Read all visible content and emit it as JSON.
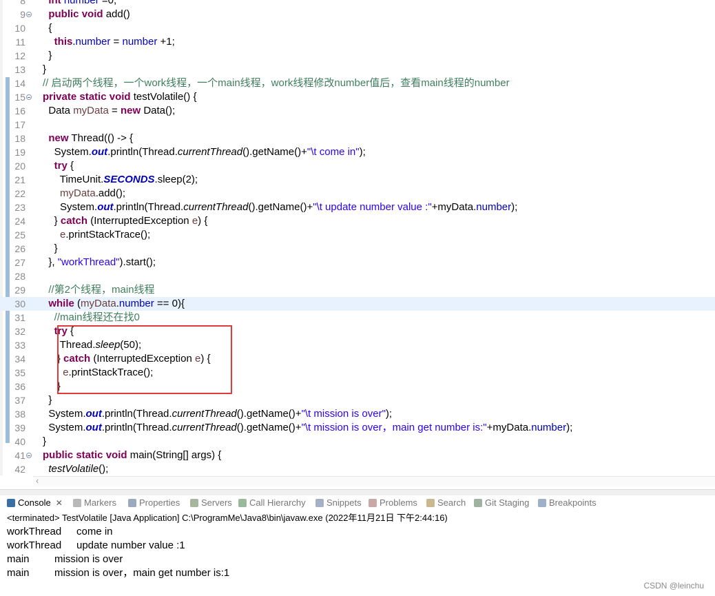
{
  "editor": {
    "lines": [
      {
        "num": "8",
        "fold": false,
        "tokens": [
          [
            "  ",
            ""
          ],
          [
            "int",
            "kw"
          ],
          [
            " ",
            ""
          ],
          [
            "number",
            "fld"
          ],
          [
            " =0;",
            ""
          ]
        ]
      },
      {
        "num": "9",
        "fold": true,
        "tokens": [
          [
            "  ",
            ""
          ],
          [
            "public",
            "kw"
          ],
          [
            " ",
            ""
          ],
          [
            "void",
            "kw"
          ],
          [
            " add()",
            ""
          ]
        ]
      },
      {
        "num": "10",
        "fold": false,
        "tokens": [
          [
            "  {",
            ""
          ]
        ]
      },
      {
        "num": "11",
        "fold": false,
        "tokens": [
          [
            "    ",
            ""
          ],
          [
            "this",
            "kw"
          ],
          [
            ".",
            ""
          ],
          [
            "number",
            "fld"
          ],
          [
            " = ",
            ""
          ],
          [
            "number",
            "fld"
          ],
          [
            " +1;",
            ""
          ]
        ]
      },
      {
        "num": "12",
        "fold": false,
        "tokens": [
          [
            "  }",
            ""
          ]
        ]
      },
      {
        "num": "13",
        "fold": false,
        "tokens": [
          [
            "}",
            ""
          ]
        ]
      },
      {
        "num": "14",
        "fold": false,
        "tokens": [
          [
            "// 启动两个线程，一个work线程，一个main线程，work线程修改number值后，查看main线程的number",
            "cmt"
          ]
        ]
      },
      {
        "num": "15",
        "fold": true,
        "tokens": [
          [
            "private",
            "kw"
          ],
          [
            " ",
            ""
          ],
          [
            "static",
            "kw"
          ],
          [
            " ",
            ""
          ],
          [
            "void",
            "kw"
          ],
          [
            " testVolatile() {",
            ""
          ]
        ]
      },
      {
        "num": "16",
        "fold": false,
        "tokens": [
          [
            "  Data ",
            ""
          ],
          [
            "myData",
            "var"
          ],
          [
            " = ",
            ""
          ],
          [
            "new",
            "kw"
          ],
          [
            " Data();",
            ""
          ]
        ]
      },
      {
        "num": "17",
        "fold": false,
        "tokens": [
          [
            "",
            ""
          ]
        ]
      },
      {
        "num": "18",
        "fold": false,
        "tokens": [
          [
            "  ",
            ""
          ],
          [
            "new",
            "kw"
          ],
          [
            " Thread(() -> {",
            ""
          ]
        ]
      },
      {
        "num": "19",
        "fold": false,
        "tokens": [
          [
            "    System.",
            ""
          ],
          [
            "out",
            "sfld"
          ],
          [
            ".println(Thread.",
            ""
          ],
          [
            "currentThread",
            "it"
          ],
          [
            "().getName()+",
            ""
          ],
          [
            "\"\\t come in\"",
            "str"
          ],
          [
            ");",
            ""
          ]
        ]
      },
      {
        "num": "20",
        "fold": false,
        "tokens": [
          [
            "    ",
            ""
          ],
          [
            "try",
            "kw"
          ],
          [
            " {",
            ""
          ]
        ]
      },
      {
        "num": "21",
        "fold": false,
        "tokens": [
          [
            "      TimeUnit.",
            ""
          ],
          [
            "SECONDS",
            "sfld"
          ],
          [
            ".sleep(2);",
            ""
          ]
        ]
      },
      {
        "num": "22",
        "fold": false,
        "tokens": [
          [
            "      ",
            ""
          ],
          [
            "myData",
            "var"
          ],
          [
            ".add();",
            ""
          ]
        ]
      },
      {
        "num": "23",
        "fold": false,
        "tokens": [
          [
            "      System.",
            ""
          ],
          [
            "out",
            "sfld"
          ],
          [
            ".println(Thread.",
            ""
          ],
          [
            "currentThread",
            "it"
          ],
          [
            "().getName()+",
            ""
          ],
          [
            "\"\\t update number value :\"",
            "str"
          ],
          [
            "+myData.",
            ""
          ],
          [
            "number",
            "fld"
          ],
          [
            ");",
            ""
          ]
        ]
      },
      {
        "num": "24",
        "fold": false,
        "tokens": [
          [
            "    } ",
            ""
          ],
          [
            "catch",
            "kw"
          ],
          [
            " (InterruptedException ",
            ""
          ],
          [
            "e",
            "var"
          ],
          [
            ") {",
            ""
          ]
        ]
      },
      {
        "num": "25",
        "fold": false,
        "tokens": [
          [
            "      ",
            ""
          ],
          [
            "e",
            "var"
          ],
          [
            ".printStackTrace();",
            ""
          ]
        ]
      },
      {
        "num": "26",
        "fold": false,
        "tokens": [
          [
            "    }",
            ""
          ]
        ]
      },
      {
        "num": "27",
        "fold": false,
        "tokens": [
          [
            "  }, ",
            ""
          ],
          [
            "\"workThread\"",
            "str"
          ],
          [
            ").start();",
            ""
          ]
        ]
      },
      {
        "num": "28",
        "fold": false,
        "tokens": [
          [
            "",
            ""
          ]
        ]
      },
      {
        "num": "29",
        "fold": false,
        "tokens": [
          [
            "  ",
            ""
          ],
          [
            "//第2个线程，main线程",
            "cmt"
          ]
        ]
      },
      {
        "num": "30",
        "fold": false,
        "current": true,
        "tokens": [
          [
            "  ",
            ""
          ],
          [
            "while",
            "kw"
          ],
          [
            " (",
            ""
          ],
          [
            "myData",
            "var"
          ],
          [
            ".",
            ""
          ],
          [
            "number",
            "fld"
          ],
          [
            " == 0){",
            ""
          ]
        ]
      },
      {
        "num": "31",
        "fold": false,
        "tokens": [
          [
            "    ",
            ""
          ],
          [
            "//main线程还在找0",
            "cmt"
          ]
        ]
      },
      {
        "num": "32",
        "fold": false,
        "tokens": [
          [
            "    ",
            ""
          ],
          [
            "try",
            "kw"
          ],
          [
            " {",
            ""
          ]
        ]
      },
      {
        "num": "33",
        "fold": false,
        "tokens": [
          [
            "      Thread.",
            ""
          ],
          [
            "sleep",
            "it"
          ],
          [
            "(50);",
            ""
          ]
        ]
      },
      {
        "num": "34",
        "fold": false,
        "tokens": [
          [
            "     } ",
            ""
          ],
          [
            "catch",
            "kw"
          ],
          [
            " (InterruptedException ",
            ""
          ],
          [
            "e",
            "var"
          ],
          [
            ") {",
            ""
          ]
        ]
      },
      {
        "num": "35",
        "fold": false,
        "tokens": [
          [
            "       ",
            ""
          ],
          [
            "e",
            "var"
          ],
          [
            ".printStackTrace();",
            ""
          ]
        ]
      },
      {
        "num": "36",
        "fold": false,
        "tokens": [
          [
            "     }",
            ""
          ]
        ]
      },
      {
        "num": "37",
        "fold": false,
        "tokens": [
          [
            "  }",
            ""
          ]
        ]
      },
      {
        "num": "38",
        "fold": false,
        "tokens": [
          [
            "  System.",
            ""
          ],
          [
            "out",
            "sfld"
          ],
          [
            ".println(Thread.",
            ""
          ],
          [
            "currentThread",
            "it"
          ],
          [
            "().getName()+",
            ""
          ],
          [
            "\"\\t mission is over\"",
            "str"
          ],
          [
            ");",
            ""
          ]
        ]
      },
      {
        "num": "39",
        "fold": false,
        "tokens": [
          [
            "  System.",
            ""
          ],
          [
            "out",
            "sfld"
          ],
          [
            ".println(Thread.",
            ""
          ],
          [
            "currentThread",
            "it"
          ],
          [
            "().getName()+",
            ""
          ],
          [
            "\"\\t mission is over，main get number is:\"",
            "str"
          ],
          [
            "+myData.",
            ""
          ],
          [
            "number",
            "fld"
          ],
          [
            ");",
            ""
          ]
        ]
      },
      {
        "num": "40",
        "fold": false,
        "tokens": [
          [
            "}",
            ""
          ]
        ]
      },
      {
        "num": "41",
        "fold": true,
        "tokens": [
          [
            "public",
            "kw"
          ],
          [
            " ",
            ""
          ],
          [
            "static",
            "kw"
          ],
          [
            " ",
            ""
          ],
          [
            "void",
            "kw"
          ],
          [
            " main(String[] args) {",
            ""
          ]
        ]
      },
      {
        "num": "42",
        "fold": false,
        "tokens": [
          [
            "  ",
            ""
          ],
          [
            "testVolatile",
            "it"
          ],
          [
            "();",
            ""
          ]
        ]
      }
    ],
    "hscroll_glyph": "‹"
  },
  "console": {
    "tabs": [
      {
        "label": "Console",
        "icon": "console-icon",
        "color": "#3a6ea5",
        "active": true
      },
      {
        "label": "Markers",
        "icon": "markers-icon",
        "color": "#b8b8b8"
      },
      {
        "label": "Properties",
        "icon": "properties-icon",
        "color": "#9aa9bd"
      },
      {
        "label": "Servers",
        "icon": "servers-icon",
        "color": "#a8b6a0"
      },
      {
        "label": "Call Hierarchy",
        "icon": "call-hierarchy-icon",
        "color": "#9ab89a"
      },
      {
        "label": "Snippets",
        "icon": "snippets-icon",
        "color": "#a6b0c4"
      },
      {
        "label": "Problems",
        "icon": "problems-icon",
        "color": "#c9a8a8"
      },
      {
        "label": "Search",
        "icon": "search-icon",
        "color": "#c9b890"
      },
      {
        "label": "Git Staging",
        "icon": "git-staging-icon",
        "color": "#9fb3a0"
      },
      {
        "label": "Breakpoints",
        "icon": "breakpoints-icon",
        "color": "#9fb0c9"
      }
    ],
    "close_glyph": "✕",
    "status": "<terminated> TestVolatile [Java Application] C:\\ProgramMe\\Java8\\bin\\javaw.exe  (2022年11月21日 下午2:44:16)",
    "output": [
      {
        "name": "workThread",
        "msg": "come in"
      },
      {
        "name": "workThread",
        "msg": "update number value :1"
      },
      {
        "name": "main",
        "msg": "mission is over"
      },
      {
        "name": "main",
        "msg": "mission is over，main get number is:1"
      }
    ]
  },
  "watermark": "CSDN @leinchu",
  "colors": {
    "highlight_box": "#e03a3a",
    "current_line": "#e8f2fe",
    "gutter_bar": "#4f87c2"
  }
}
